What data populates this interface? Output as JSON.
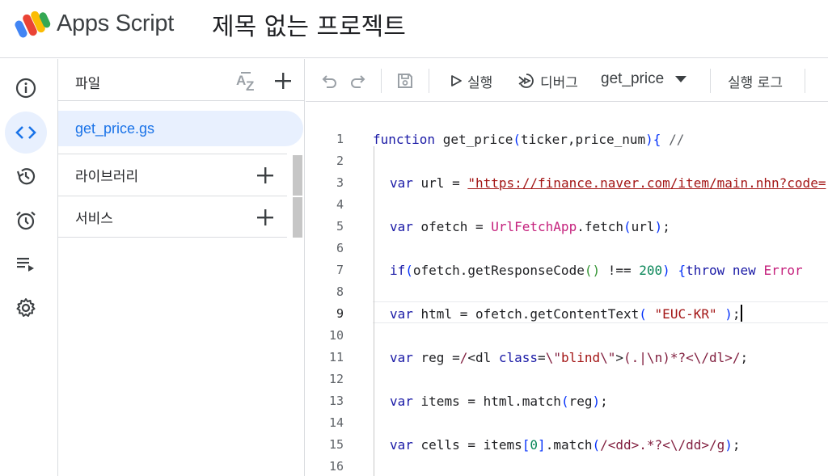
{
  "header": {
    "app_title": "Apps Script",
    "project_title": "제목 없는 프로젝트"
  },
  "rail": {
    "items": [
      "overview",
      "editor",
      "triggers",
      "executions",
      "project-history",
      "settings"
    ],
    "active": "editor"
  },
  "files_panel": {
    "label": "파일",
    "files": [
      {
        "name": "get_price.gs",
        "selected": true
      }
    ],
    "sections": [
      {
        "label": "라이브러리"
      },
      {
        "label": "서비스"
      }
    ]
  },
  "toolbar": {
    "run_label": "실행",
    "debug_label": "디버그",
    "function_selected": "get_price",
    "log_label": "실행 로그"
  },
  "editor": {
    "current_line": 9,
    "line_numbers": [
      "1",
      "2",
      "3",
      "4",
      "5",
      "6",
      "7",
      "8",
      "9",
      "10",
      "11",
      "12",
      "13",
      "14",
      "15",
      "16"
    ]
  },
  "colors": {
    "accent": "#1a73e8",
    "active_bg": "#e8f0fe",
    "border": "#dadce0"
  }
}
